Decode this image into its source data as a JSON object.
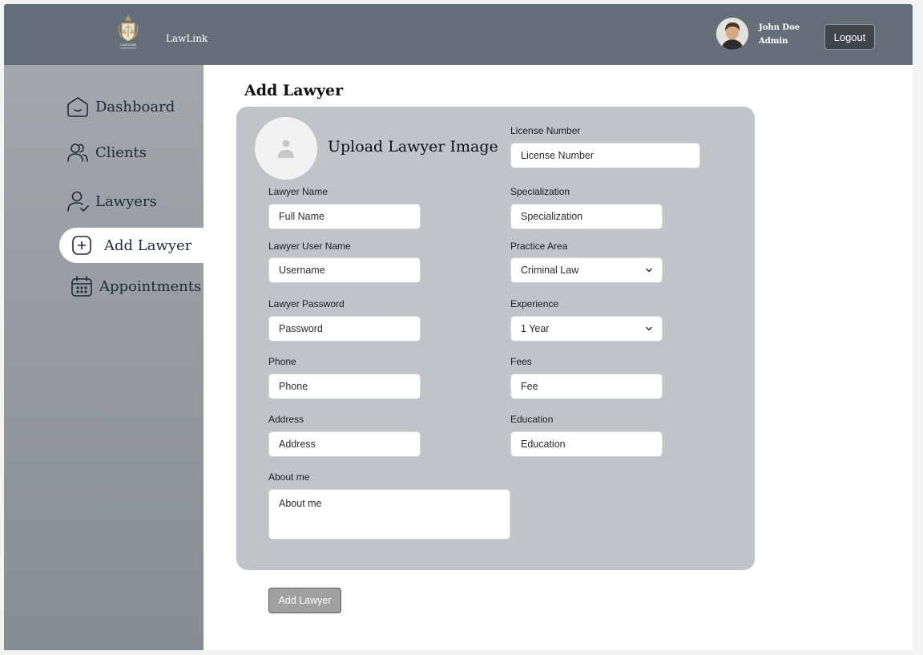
{
  "header": {
    "brand": "LawLink",
    "logo_text": "LAWLINK",
    "user_name": "John Doe",
    "user_role": "Admin",
    "logout_label": "Logout"
  },
  "sidebar": {
    "items": [
      {
        "label": "Dashboard",
        "icon": "home-icon"
      },
      {
        "label": "Clients",
        "icon": "users-icon"
      },
      {
        "label": "Lawyers",
        "icon": "user-check-icon"
      },
      {
        "label": "Add Lawyer",
        "icon": "plus-square-icon",
        "active": true
      },
      {
        "label": "Appointments",
        "icon": "calendar-icon"
      }
    ]
  },
  "main": {
    "title": "Add Lawyer",
    "upload_label": "Upload Lawyer Image",
    "fields": {
      "license": {
        "label": "License Number",
        "placeholder": "License Number"
      },
      "name": {
        "label": "Lawyer Name",
        "placeholder": "Full Name"
      },
      "specialization": {
        "label": "Specialization",
        "placeholder": "Specialization"
      },
      "username": {
        "label": "Lawyer User Name",
        "placeholder": "Username"
      },
      "practice_area": {
        "label": "Practice Area",
        "value": "Criminal Law"
      },
      "password": {
        "label": "Lawyer Password",
        "placeholder": "Password"
      },
      "experience": {
        "label": "Experience",
        "value": "1 Year"
      },
      "phone": {
        "label": "Phone",
        "placeholder": "Phone"
      },
      "fees": {
        "label": "Fees",
        "placeholder": "Fee"
      },
      "address": {
        "label": "Address",
        "placeholder": "Address"
      },
      "education": {
        "label": "Education",
        "placeholder": "Education"
      },
      "about": {
        "label": "About me",
        "placeholder": "About me"
      }
    },
    "submit_label": "Add Lawyer"
  },
  "colors": {
    "header_bg": "#646f79",
    "sidebar_top": "#a2a7ac",
    "sidebar_bottom": "#868d94",
    "card_bg": "#c0c3c7",
    "nav_text": "#1f2a3c",
    "logo_gold": "#b8a06a"
  }
}
